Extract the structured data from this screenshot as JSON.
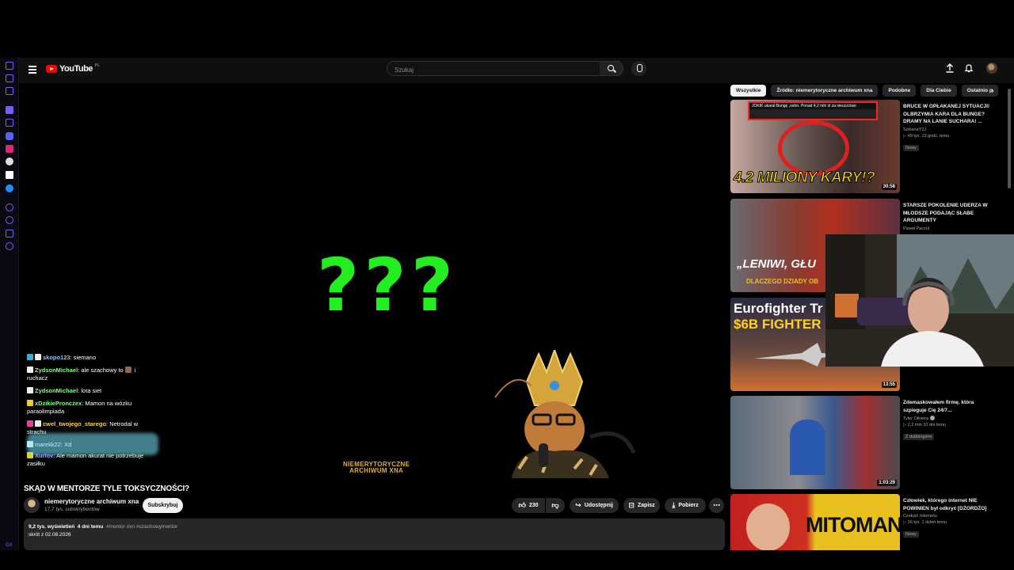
{
  "header": {
    "logo_text": "YouTube",
    "logo_sup": "PL",
    "search_placeholder": "Szukaj"
  },
  "video": {
    "overlay_text": "???",
    "watermark_line1": "NIEMERYTORYCZNE",
    "watermark_line2": "ARCHIWUM XNA"
  },
  "chat": [
    {
      "user": "skopo123",
      "text": "siemano",
      "color": "#7ec8ff"
    },
    {
      "user": "ZydsonMichael",
      "text": "ale szachowy to",
      "text2": "i ruchacz",
      "color": "#7dff7d"
    },
    {
      "user": "ZydsonMichael",
      "text": "lota siet",
      "color": "#7dff7d"
    },
    {
      "user": "xDzikiePronczex",
      "text": "Mamon na wózku paraolimpiada",
      "color": "#7dff7d"
    },
    {
      "user": "cwel_twojego_starego",
      "text": "Netrodal w strachu",
      "color": "#ffd23f"
    },
    {
      "user": "marekk22",
      "text": "Xd",
      "color": "#ffffff"
    },
    {
      "user": "Xurlov",
      "text": "Ale mamon akurat nie potrzebuje zasiłku",
      "color": "#9b8cff"
    }
  ],
  "title": "SKĄD W MENTORZE TYLE TOKSYCZNOŚCI?",
  "channel": {
    "name": "niemerytoryczne archiwum xna",
    "subs": "17,7 tys. subskrybentów",
    "subscribe_label": "Subskrybuj"
  },
  "actions": {
    "likes": "230",
    "share": "Udostępnij",
    "save": "Zapisz",
    "download": "Pobierz"
  },
  "description": {
    "views": "9,2 tys. wyświetleń",
    "age": "4 dni temu",
    "tags": "#mentor #xn #szachowymentor",
    "line2": "skrót z 02.08.2026"
  },
  "chips": [
    "Wszystkie",
    "Źródło: niemerytoryczne archiwum xna",
    "Podobne",
    "Dla Ciebie",
    "Ostatnio p"
  ],
  "recommendations": [
    {
      "title": "BRUCE W OPŁAKANEJ SYTUACJI! OLBRZYMIA KARA DLA BUNGE? DRAMY NA LANIE SUCHARA! ...",
      "channel": "SzklanaY2J",
      "stats": "▷ 49 tys.   13 godz. temu",
      "badge": "Nowy",
      "duration": "30:58",
      "thumb_text": "4.2 MILIONY KARY!?",
      "thumb_banner": "JOKIK ukarał Bungę ,ostro. Ponad 4,2 mln zł za nieuczciwe"
    },
    {
      "title": "STARSZE POKOLENIE UDERZA W MŁODSZE PODAJĄC SŁABE ARGUMENTY",
      "channel": "Paweł Paczul",
      "stats": "",
      "badge": "",
      "duration": "",
      "thumb_text": "„LENIWI, GŁU",
      "thumb_sub": "DLACZEGO DZIADY OB"
    },
    {
      "title": "",
      "channel": "",
      "stats": "",
      "badge": "",
      "duration": "13:55",
      "thumb_text": "Eurofighter Tr",
      "thumb_sub": "$6B FIGHTER U"
    },
    {
      "title": "Zdemaskowałem firmę, która szpieguje Cię 24/7...",
      "channel": "Tyler Oliveira",
      "stats": "▷ 2,2 mln   10 dni temu",
      "badge": "Z dubbingiem",
      "duration": "1:03:29",
      "thumb_text": ""
    },
    {
      "title": "Człowiek, którego internet NIE POWINIEN był odkryć [DŻORDŻO]",
      "channel": "Czełuść Internetu",
      "stats": "▷ 16 tys.   1 dzień temu",
      "badge": "Nowy",
      "duration": "",
      "thumb_text": "MITOMAN"
    }
  ],
  "extension_label": "GX"
}
